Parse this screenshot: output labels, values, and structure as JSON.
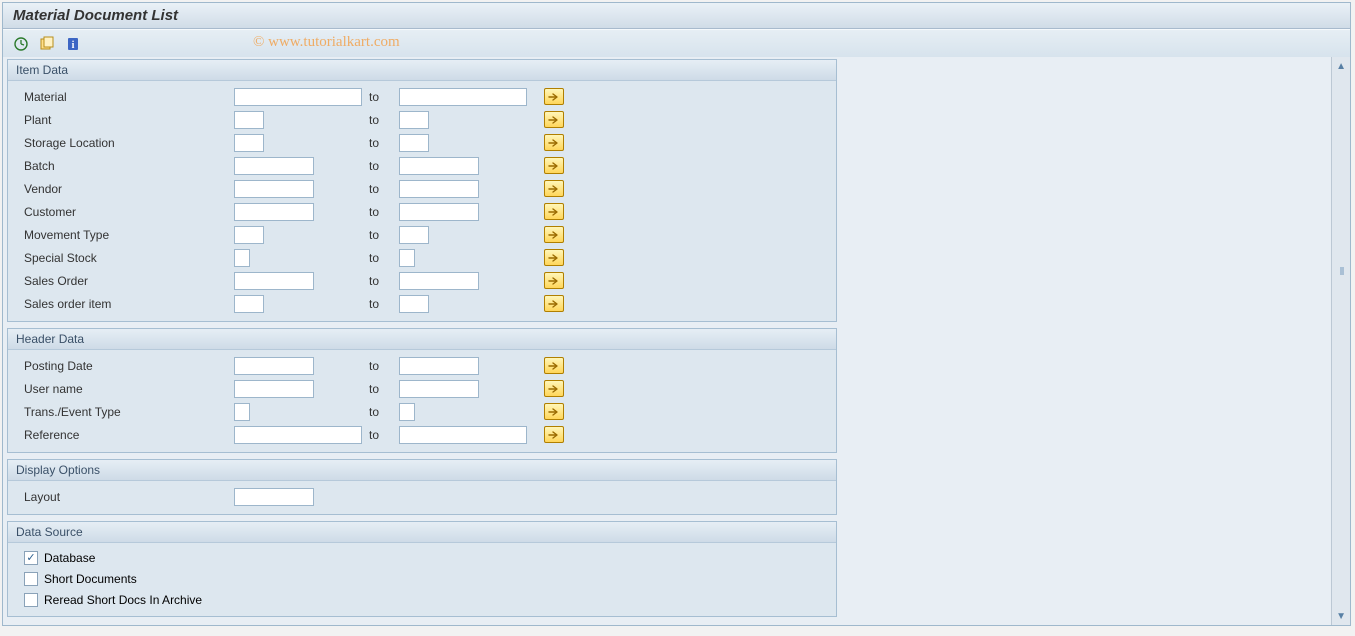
{
  "title": "Material Document List",
  "watermark": "© www.tutorialkart.com",
  "to_label": "to",
  "groups": {
    "item_data": {
      "title": "Item Data",
      "rows": [
        {
          "label": "Material",
          "key": "material",
          "from_w": "w-wide",
          "to_w": "w-wide"
        },
        {
          "label": "Plant",
          "key": "plant",
          "from_w": "w-short",
          "to_w": "w-short"
        },
        {
          "label": "Storage Location",
          "key": "storage-location",
          "from_w": "w-short",
          "to_w": "w-short"
        },
        {
          "label": "Batch",
          "key": "batch",
          "from_w": "w-med",
          "to_w": "w-med"
        },
        {
          "label": "Vendor",
          "key": "vendor",
          "from_w": "w-med",
          "to_w": "w-med"
        },
        {
          "label": "Customer",
          "key": "customer",
          "from_w": "w-med",
          "to_w": "w-med"
        },
        {
          "label": "Movement Type",
          "key": "movement-type",
          "from_w": "w-short",
          "to_w": "w-short"
        },
        {
          "label": "Special Stock",
          "key": "special-stock",
          "from_w": "w-tiny",
          "to_w": "w-tiny"
        },
        {
          "label": "Sales Order",
          "key": "sales-order",
          "from_w": "w-med",
          "to_w": "w-med"
        },
        {
          "label": "Sales order item",
          "key": "sales-order-item",
          "from_w": "w-short",
          "to_w": "w-short"
        }
      ]
    },
    "header_data": {
      "title": "Header Data",
      "rows": [
        {
          "label": "Posting Date",
          "key": "posting-date",
          "from_w": "w-med",
          "to_w": "w-med"
        },
        {
          "label": "User name",
          "key": "user-name",
          "from_w": "w-med",
          "to_w": "w-med"
        },
        {
          "label": "Trans./Event Type",
          "key": "trans-event-type",
          "from_w": "w-tiny",
          "to_w": "w-tiny"
        },
        {
          "label": "Reference",
          "key": "reference",
          "from_w": "w-wide",
          "to_w": "w-wide"
        }
      ]
    },
    "display_options": {
      "title": "Display Options",
      "layout_label": "Layout"
    },
    "data_source": {
      "title": "Data Source",
      "checks": [
        {
          "label": "Database",
          "key": "database",
          "checked": true
        },
        {
          "label": "Short Documents",
          "key": "short-docs",
          "checked": false
        },
        {
          "label": "Reread Short Docs In Archive",
          "key": "reread-arc",
          "checked": false
        }
      ]
    }
  }
}
